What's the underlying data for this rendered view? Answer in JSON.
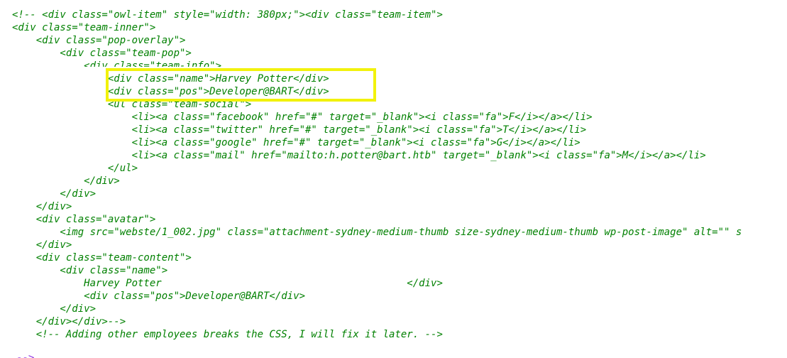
{
  "source": {
    "lines": [
      "<!-- <div class=\"owl-item\" style=\"width: 380px;\"><div class=\"team-item\">",
      "<div class=\"team-inner\">",
      "    <div class=\"pop-overlay\">",
      "        <div class=\"team-pop\">",
      "            <div class=\"team-info\">",
      "                <div class=\"name\">Harvey Potter</div>",
      "                <div class=\"pos\">Developer@BART</div>",
      "                <ul class=\"team-social\">",
      "                    <li><a class=\"facebook\" href=\"#\" target=\"_blank\"><i class=\"fa\">F</i></a></li>",
      "                    <li><a class=\"twitter\" href=\"#\" target=\"_blank\"><i class=\"fa\">T</i></a></li>",
      "                    <li><a class=\"google\" href=\"#\" target=\"_blank\"><i class=\"fa\">G</i></a></li>",
      "                    <li><a class=\"mail\" href=\"mailto:h.potter@bart.htb\" target=\"_blank\"><i class=\"fa\">M</i></a></li>",
      "                </ul>",
      "            </div>",
      "        </div>",
      "    </div>",
      "    <div class=\"avatar\">",
      "        <img src=\"webste/1_002.jpg\" class=\"attachment-sydney-medium-thumb size-sydney-medium-thumb wp-post-image\" alt=\"\" s",
      "    </div>",
      "    <div class=\"team-content\">",
      "        <div class=\"name\">",
      "            Harvey Potter                                         </div>",
      "            <div class=\"pos\">Developer@BART</div>",
      "        </div>",
      "    </div></div>-->",
      "    <!-- Adding other employees breaks the CSS, I will fix it later. -->"
    ],
    "next_line_fragment": "-->",
    "colors": {
      "comment_text": "#008000",
      "highlight_border": "#f2f20c",
      "background": "#ffffff"
    }
  }
}
